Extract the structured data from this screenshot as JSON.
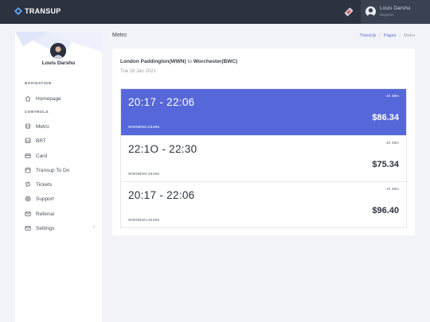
{
  "brand": {
    "name": "TRANSUP"
  },
  "topbar": {
    "user_name": "Louis Darshu",
    "user_role": "Beginner"
  },
  "sidebar": {
    "profile_name": "Louis Darshu",
    "sections": {
      "navigation": "NAVIGATION",
      "controls": "CONTROLS"
    },
    "items": [
      {
        "label": "Homepage",
        "icon": "home-icon"
      },
      {
        "label": "Metro",
        "icon": "train-icon"
      },
      {
        "label": "BRT",
        "icon": "bus-icon"
      },
      {
        "label": "Card",
        "icon": "card-icon"
      },
      {
        "label": "Transup To Do",
        "icon": "calendar-icon"
      },
      {
        "label": "Tickets",
        "icon": "ticket-icon"
      },
      {
        "label": "Support",
        "icon": "support-icon"
      },
      {
        "label": "Referral",
        "icon": "mail-icon"
      },
      {
        "label": "Settings",
        "icon": "mail-icon"
      }
    ]
  },
  "page": {
    "title": "Metro"
  },
  "breadcrumb": {
    "items": [
      "TransUp",
      "Pages",
      "Metro"
    ]
  },
  "route": {
    "from": "London Paddington(WWN)",
    "to_word": "to",
    "to": "Worchester(BWC)",
    "date": "Tue 28 Jan 2021"
  },
  "trips": [
    {
      "time": "20:17 - 22:06",
      "duration": "1h 49m",
      "price": "$86.34",
      "code": "WWNBWC45466",
      "selected": true
    },
    {
      "time": "22:1O - 22:30",
      "duration": "1h 49m",
      "price": "$75.34",
      "code": "WWNBWC45466",
      "selected": false
    },
    {
      "time": "20:17 - 22:06",
      "duration": "1h 49m",
      "price": "$96.40",
      "code": "WWNBWC45466",
      "selected": false
    }
  ],
  "colors": {
    "accent": "#5668d9",
    "topbar": "#2c323f",
    "background": "#f1f3f8"
  }
}
